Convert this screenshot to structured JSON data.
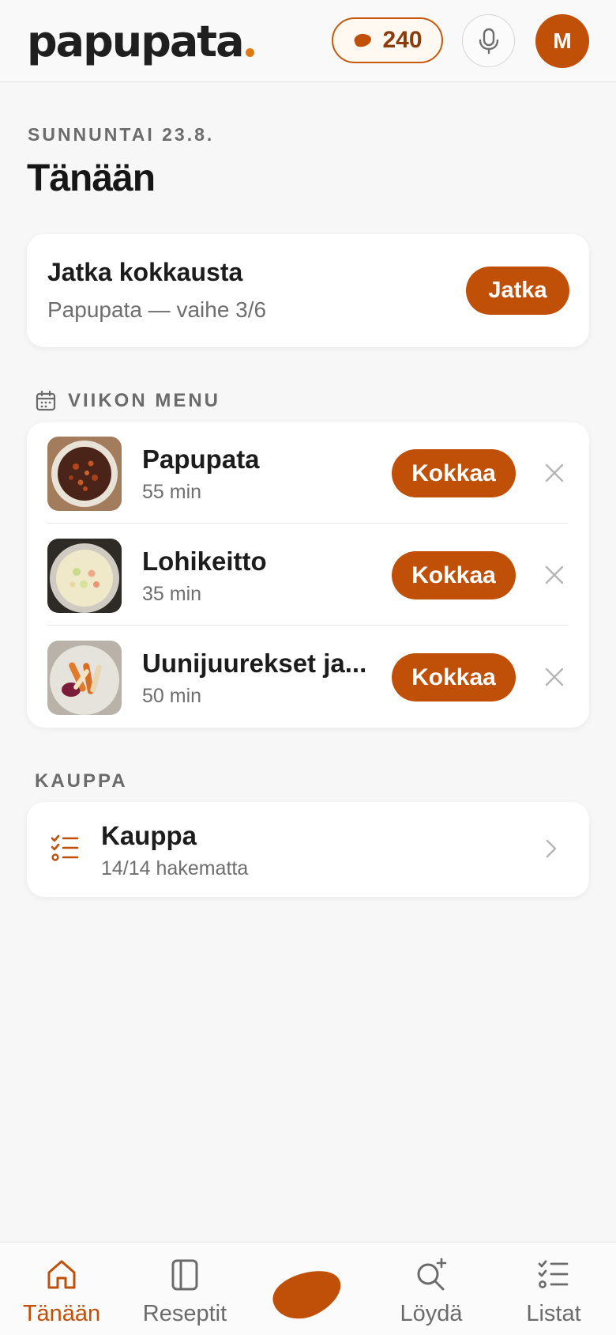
{
  "header": {
    "logo_text": "papupata",
    "beans_count": "240",
    "avatar_initial": "M",
    "icons": {
      "bean": "bean-icon",
      "mic": "microphone-icon"
    }
  },
  "colors": {
    "accent": "#c04f08",
    "accent_dot": "#e07a10",
    "background": "#f7f7f7"
  },
  "page": {
    "date_label": "SUNNUNTAI 23.8.",
    "title": "Tänään"
  },
  "continue_card": {
    "title": "Jatka kokkausta",
    "subtitle": "Papupata — vaihe 3/6",
    "button_label": "Jatka"
  },
  "weekly_menu": {
    "heading": "VIIKON MENU",
    "items": [
      {
        "title": "Papupata",
        "time": "55 min",
        "button_label": "Kokkaa"
      },
      {
        "title": "Lohikeitto",
        "time": "35 min",
        "button_label": "Kokkaa"
      },
      {
        "title": "Uunijuurekset ja...",
        "time": "50 min",
        "button_label": "Kokkaa"
      }
    ]
  },
  "shopping": {
    "heading": "KAUPPA",
    "card_title": "Kauppa",
    "card_subtitle": "14/14 hakematta"
  },
  "bottom_nav": {
    "active": "Tänään",
    "items": [
      {
        "label": "Tänään",
        "icon": "home-icon"
      },
      {
        "label": "Reseptit",
        "icon": "book-icon"
      },
      {
        "label": "",
        "icon": "bean-icon"
      },
      {
        "label": "Löydä",
        "icon": "search-plus-icon"
      },
      {
        "label": "Listat",
        "icon": "checklist-icon"
      }
    ]
  }
}
